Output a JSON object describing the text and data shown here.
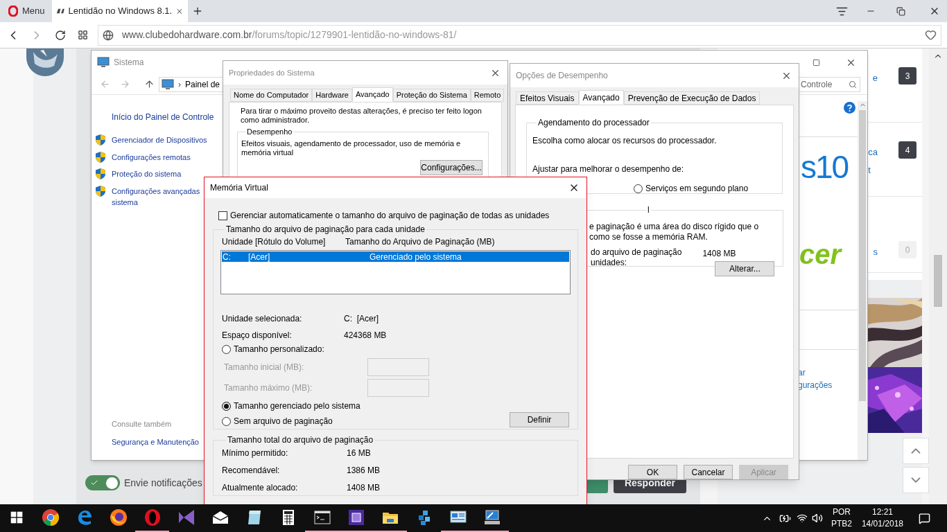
{
  "browser": {
    "menu_label": "Menu",
    "tabs": [
      {
        "label": "Lentidão no Windows 8.1.",
        "selected": true
      }
    ],
    "url_host": "www.clubedohardware.com.br",
    "url_path": "/forums/topic/1279901-lentidão-no-windows-81/"
  },
  "forum": {
    "notify": {
      "label": "Envie notificações",
      "on": true
    },
    "reply_button": "Responder",
    "sidebar_items": [
      {
        "fragment": "e",
        "count": "3",
        "kind": "dark"
      },
      {
        "fragment": "ca",
        "fragment_2": "t",
        "count": "4",
        "kind": "dark"
      },
      {
        "fragment": "s",
        "count": "0",
        "kind": "light"
      }
    ]
  },
  "sistema": {
    "title": "Sistema",
    "breadcrumb_separator": "›",
    "breadcrumb": "Painel de",
    "search_placeholder": "Controle",
    "home_link": "Início do Painel de Controle",
    "links": [
      {
        "lines": [
          "Gerenciador de Dispositivos"
        ]
      },
      {
        "lines": [
          "Configurações remotas"
        ]
      },
      {
        "lines": [
          "Proteção do sistema"
        ]
      },
      {
        "lines": [
          "Configurações avançadas",
          "sistema"
        ]
      }
    ],
    "see_also": "Consulte também",
    "see_also_links": [
      "Segurança e Manutenção"
    ],
    "logo_text": "s10",
    "brand_text": "cer",
    "right_links": [
      "ar",
      "gurações"
    ]
  },
  "system_properties": {
    "title": "Propriedades do Sistema",
    "tabs": [
      {
        "label": "Nome do Computador",
        "selected": false
      },
      {
        "label": "Hardware",
        "selected": false
      },
      {
        "label": "Avançado",
        "selected": true
      },
      {
        "label": "Proteção do Sistema",
        "selected": false
      },
      {
        "label": "Remoto",
        "selected": false
      }
    ],
    "intro": "Para tirar o máximo proveito destas alterações, é preciso ter feito logon como administrador.",
    "group": "Desempenho",
    "group_text": "Efeitos visuais, agendamento de processador, uso de memória e memória virtual",
    "button": "Configurações..."
  },
  "performance_options": {
    "title": "Opções de Desempenho",
    "tabs": [
      {
        "label": "Efeitos Visuais",
        "selected": false
      },
      {
        "label": "Avançado",
        "selected": true
      },
      {
        "label": "Prevenção de Execução de Dados",
        "selected": false
      }
    ],
    "scheduling": {
      "title": "Agendamento do processador",
      "text": "Escolha como alocar os recursos do processador.",
      "prompt": "Ajustar para melhorar o desempenho de:",
      "radio": {
        "label": "Serviços em segundo plano",
        "selected": false
      }
    },
    "memory": {
      "title": "l",
      "line_1": "e paginação é uma área do disco rígido que o",
      "line_2": "como se fosse a memória RAM.",
      "total_label_1": "do arquivo de paginação",
      "total_label_2": "unidades:",
      "total_value": "1408 MB",
      "button": "Alterar..."
    },
    "buttons": [
      {
        "label": "OK",
        "disabled": false
      },
      {
        "label": "Cancelar",
        "disabled": false
      },
      {
        "label": "Aplicar",
        "disabled": true
      }
    ]
  },
  "virtual_memory": {
    "title": "Memória Virtual",
    "auto_manage": {
      "label": "Gerenciar automaticamente o tamanho do arquivo de paginação de todas as unidades",
      "checked": false
    },
    "drives_group": "Tamanho do arquivo de paginação para cada unidade",
    "columns": [
      "Unidade [Rótulo do Volume]",
      "Tamanho do Arquivo de Paginação (MB)"
    ],
    "drives": [
      {
        "drive": "C:",
        "label": "[Acer]",
        "size": "Gerenciado pelo sistema",
        "selected": true
      }
    ],
    "info": [
      {
        "label": "Unidade selecionada:",
        "value": "C:  [Acer]"
      },
      {
        "label": "Espaço disponível:",
        "value": "424368 MB"
      }
    ],
    "options": [
      {
        "kind": "radio",
        "label": "Tamanho personalizado:",
        "selected": false
      },
      {
        "kind": "field",
        "label": "Tamanho inicial (MB):",
        "disabled": true
      },
      {
        "kind": "field",
        "label": "Tamanho máximo (MB):",
        "disabled": true
      },
      {
        "kind": "radio",
        "label": "Tamanho gerenciado pelo sistema",
        "selected": true
      },
      {
        "kind": "radio",
        "label": "Sem arquivo de paginação",
        "selected": false
      }
    ],
    "set_button": "Definir",
    "totals_group": "Tamanho total do arquivo de paginação",
    "totals": [
      {
        "label": "Mínimo permitido:",
        "value": "16 MB"
      },
      {
        "label": "Recomendável:",
        "value": "1386 MB"
      },
      {
        "label": "Atualmente alocado:",
        "value": "1408 MB"
      }
    ]
  },
  "taskbar": {
    "apps": [
      {
        "kind": "windows",
        "running": false
      },
      {
        "kind": "chrome",
        "running": false
      },
      {
        "kind": "edge",
        "running": false
      },
      {
        "kind": "firefox",
        "running": false
      },
      {
        "kind": "opera",
        "running": true
      },
      {
        "kind": "vs",
        "running": false
      },
      {
        "kind": "mail",
        "running": false
      },
      {
        "kind": "notes",
        "running": false
      },
      {
        "kind": "calculator",
        "running": false
      },
      {
        "kind": "terminal",
        "running": true
      },
      {
        "kind": "chip",
        "running": true
      },
      {
        "kind": "folder",
        "running": true
      },
      {
        "kind": "cubes",
        "running": false
      },
      {
        "kind": "panel",
        "running": true
      },
      {
        "kind": "monitor",
        "running": true
      }
    ],
    "language": "POR",
    "layout": "PTB2",
    "time": "12:21",
    "date": "14/01/2018"
  }
}
